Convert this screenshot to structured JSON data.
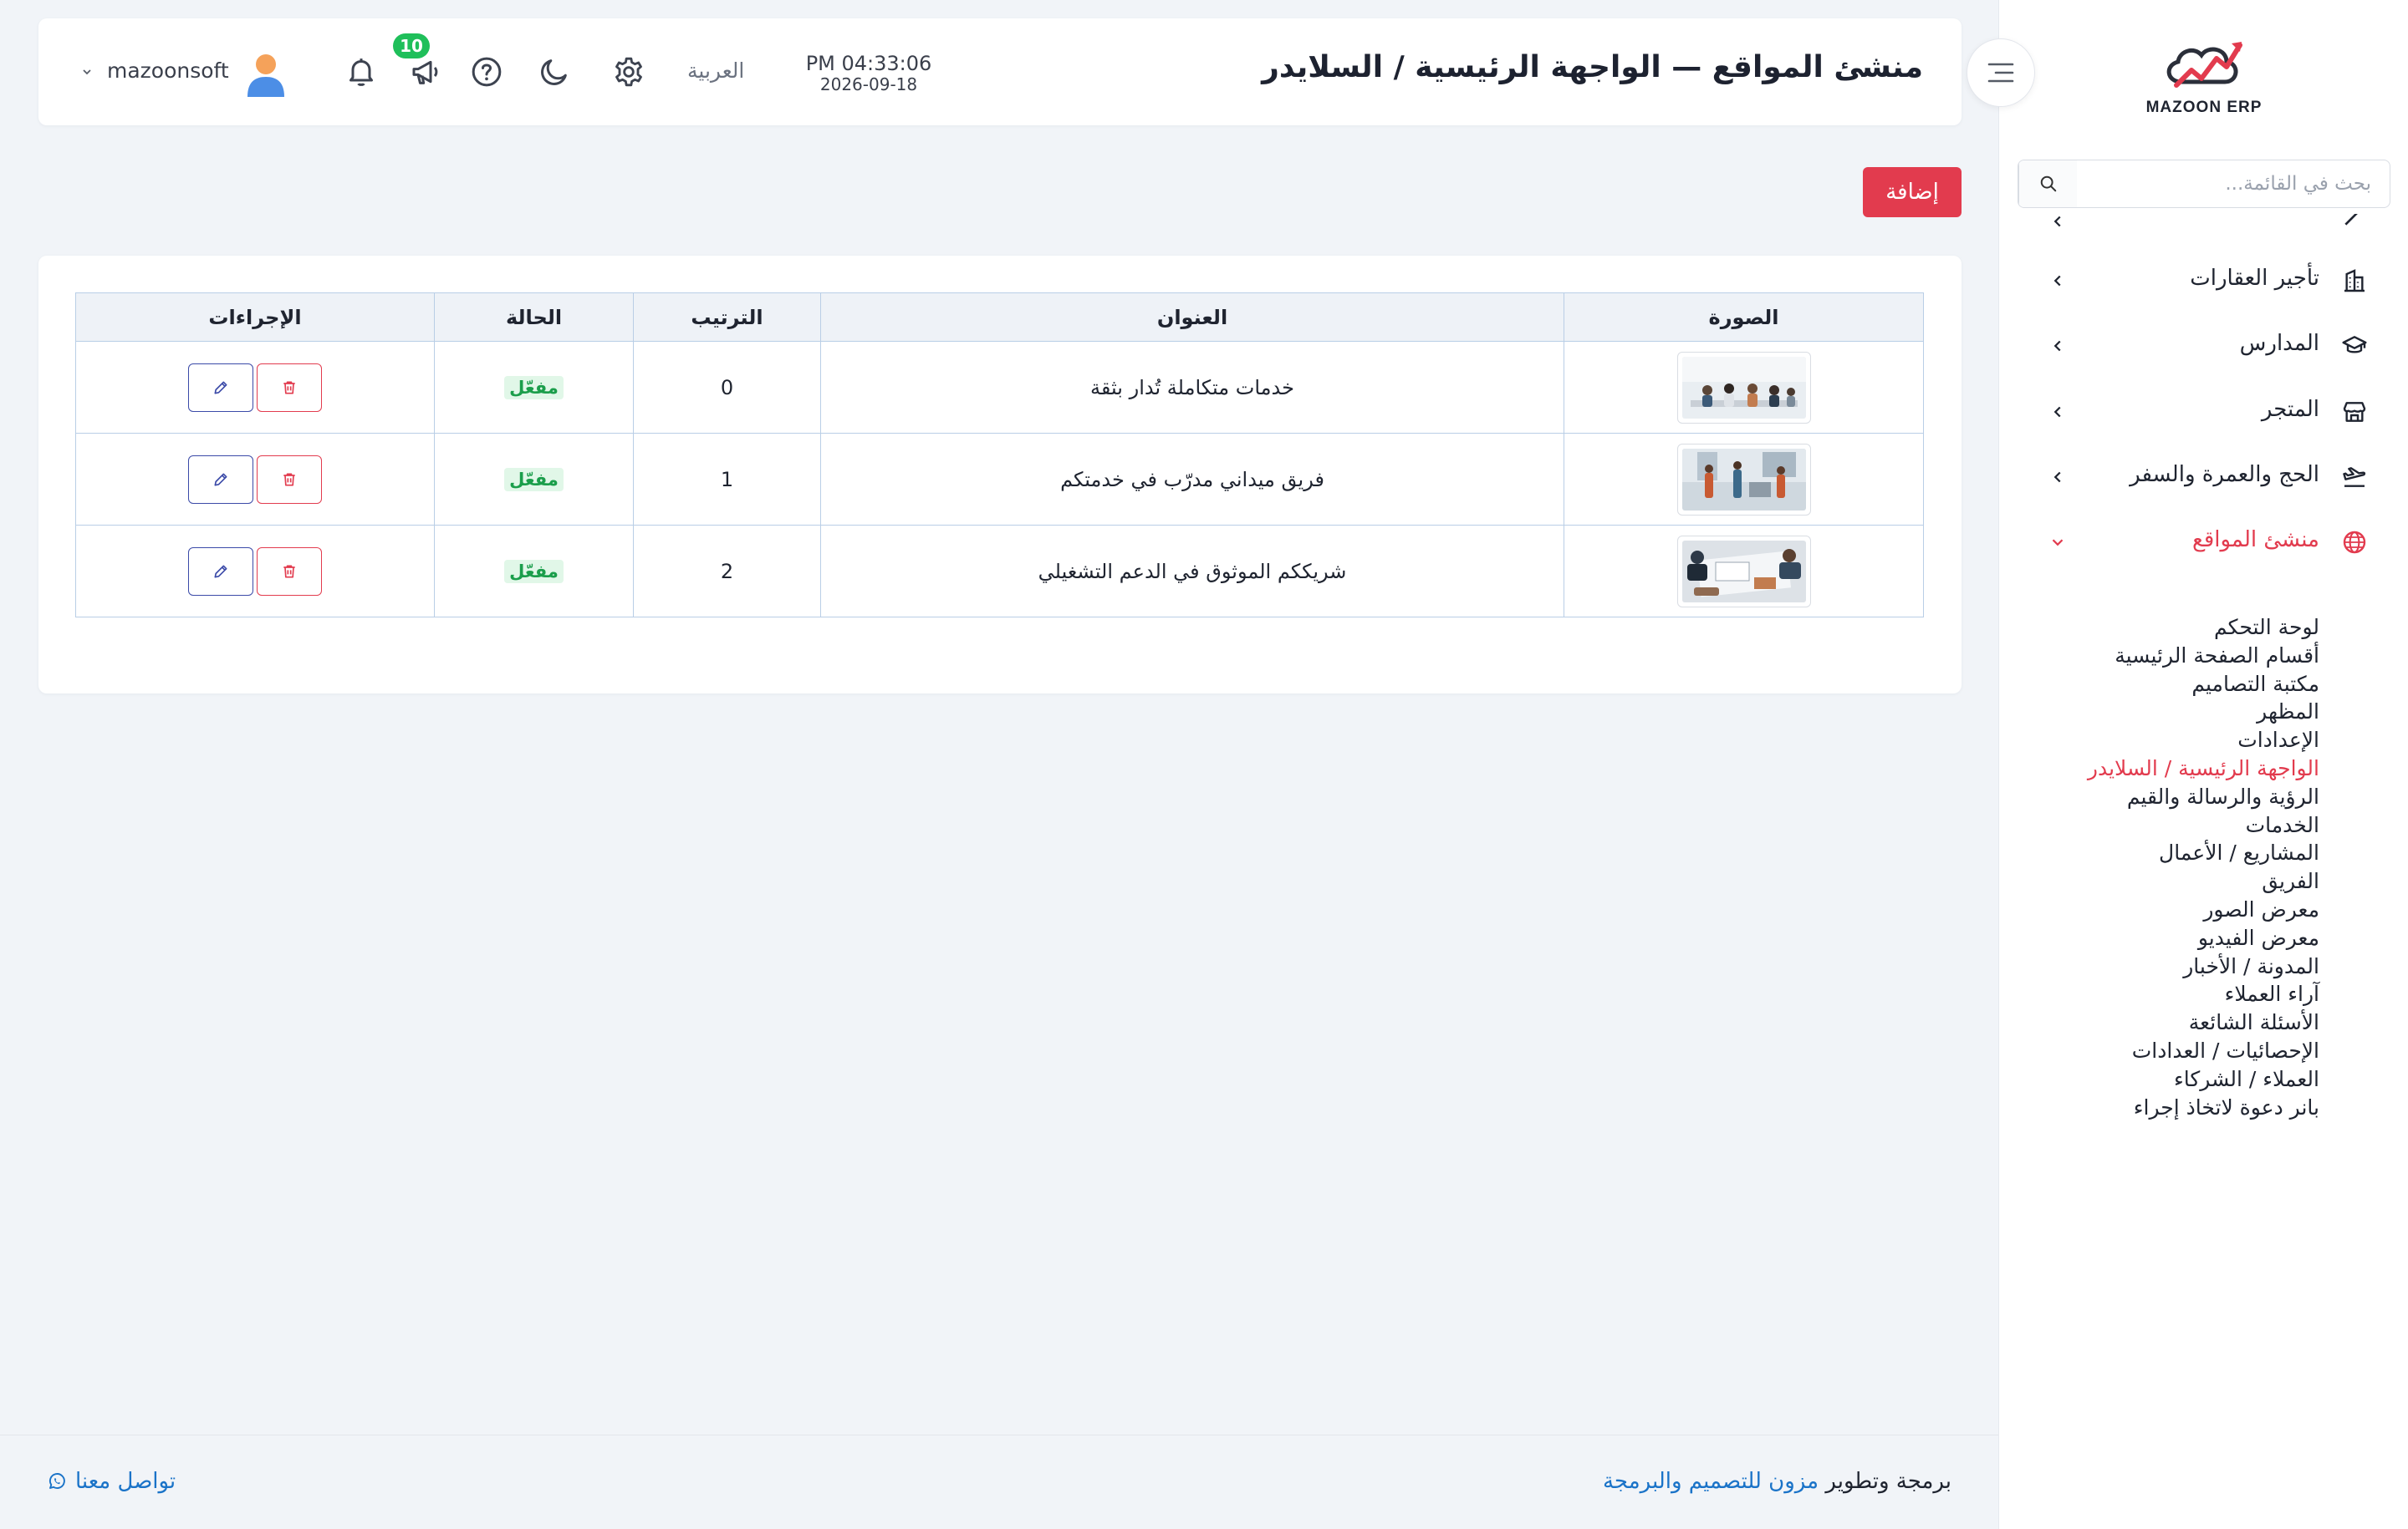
{
  "brand": {
    "name": "MAZOON ERP",
    "tagline": "مزون"
  },
  "sidebar": {
    "search_placeholder": "بحث في القائمة...",
    "items": [
      {
        "label": "تأجير العقارات",
        "icon": "building-icon"
      },
      {
        "label": "المدارس",
        "icon": "graduation-cap-icon"
      },
      {
        "label": "المتجر",
        "icon": "store-icon"
      },
      {
        "label": "الحج والعمرة والسفر",
        "icon": "plane-icon"
      },
      {
        "label": "منشئ المواقع",
        "icon": "globe-icon",
        "expanded": true
      }
    ],
    "sub_items": [
      {
        "label": "لوحة التحكم"
      },
      {
        "label": "أقسام الصفحة الرئيسية"
      },
      {
        "label": "مكتبة التصاميم"
      },
      {
        "label": "المظهر"
      },
      {
        "label": "الإعدادات"
      },
      {
        "label": "الواجهة الرئيسية / السلايدر",
        "active": true
      },
      {
        "label": "الرؤية والرسالة والقيم"
      },
      {
        "label": "الخدمات"
      },
      {
        "label": "المشاريع / الأعمال"
      },
      {
        "label": "الفريق"
      },
      {
        "label": "معرض الصور"
      },
      {
        "label": "معرض الفيديو"
      },
      {
        "label": "المدونة / الأخبار"
      },
      {
        "label": "آراء العملاء"
      },
      {
        "label": "الأسئلة الشائعة"
      },
      {
        "label": "الإحصائيات / العدادات"
      },
      {
        "label": "العملاء / الشركاء"
      },
      {
        "label": "بانر دعوة لاتخاذ إجراء"
      }
    ]
  },
  "header": {
    "title": "منشئ المواقع — الواجهة الرئيسية / السلايدر",
    "time": "PM 04:33:06",
    "date": "2026-09-18",
    "language": "العربية",
    "notification_count": "10",
    "username": "mazoonsoft"
  },
  "toolbar": {
    "add_label": "إضافة"
  },
  "table": {
    "columns": [
      "الصورة",
      "العنوان",
      "الترتيب",
      "الحالة",
      "الإجراءات"
    ],
    "rows": [
      {
        "title": "خدمات متكاملة تُدار بثقة",
        "order": "0",
        "status": "مفعّل"
      },
      {
        "title": "فريق ميداني مدرّب في خدمتكم",
        "order": "1",
        "status": "مفعّل"
      },
      {
        "title": "شريككم الموثوق في الدعم التشغيلي",
        "order": "2",
        "status": "مفعّل"
      }
    ]
  },
  "footer": {
    "credit_prefix": "برمجة وتطوير",
    "credit_link": "مزون للتصميم والبرمجة",
    "contact": "تواصل معنا"
  },
  "colors": {
    "accent": "#e23b4e",
    "success": "#1fbf5a",
    "link": "#1a73c8",
    "edit": "#3b4aa8"
  }
}
